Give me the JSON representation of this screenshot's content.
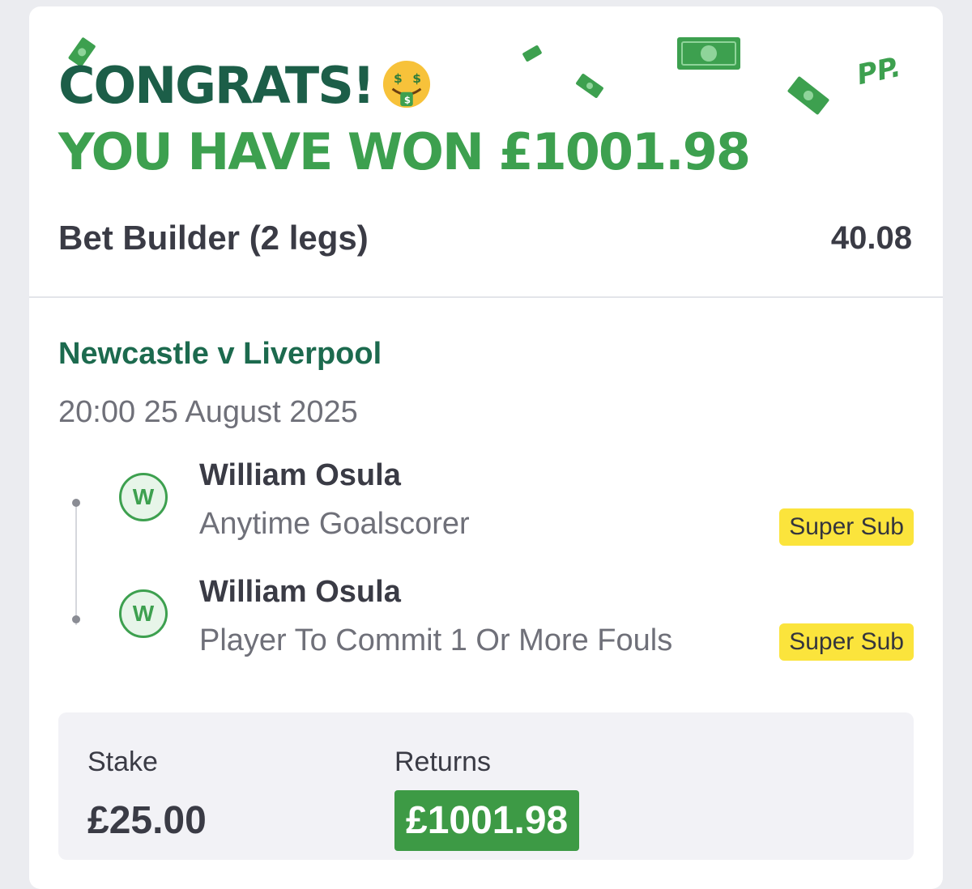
{
  "header": {
    "congrats": "CONGRATS!",
    "won_text": "YOU HAVE WON £1001.98",
    "emoji": "money-mouth-face-icon",
    "brand_logo": "PP.",
    "colors": {
      "dark_green": "#1c5e48",
      "bright_green": "#3da04f"
    }
  },
  "bet": {
    "title": "Bet Builder (2 legs)",
    "odds": "40.08"
  },
  "event": {
    "name": "Newcastle v Liverpool",
    "datetime": "20:00 25 August 2025"
  },
  "legs": [
    {
      "result": "W",
      "player": "William Osula",
      "market": "Anytime Goalscorer",
      "tag": "Super Sub"
    },
    {
      "result": "W",
      "player": "William Osula",
      "market": "Player To Commit 1 Or More Fouls",
      "tag": "Super Sub"
    }
  ],
  "summary": {
    "stake_label": "Stake",
    "stake_value": "£25.00",
    "returns_label": "Returns",
    "returns_value": "£1001.98"
  }
}
